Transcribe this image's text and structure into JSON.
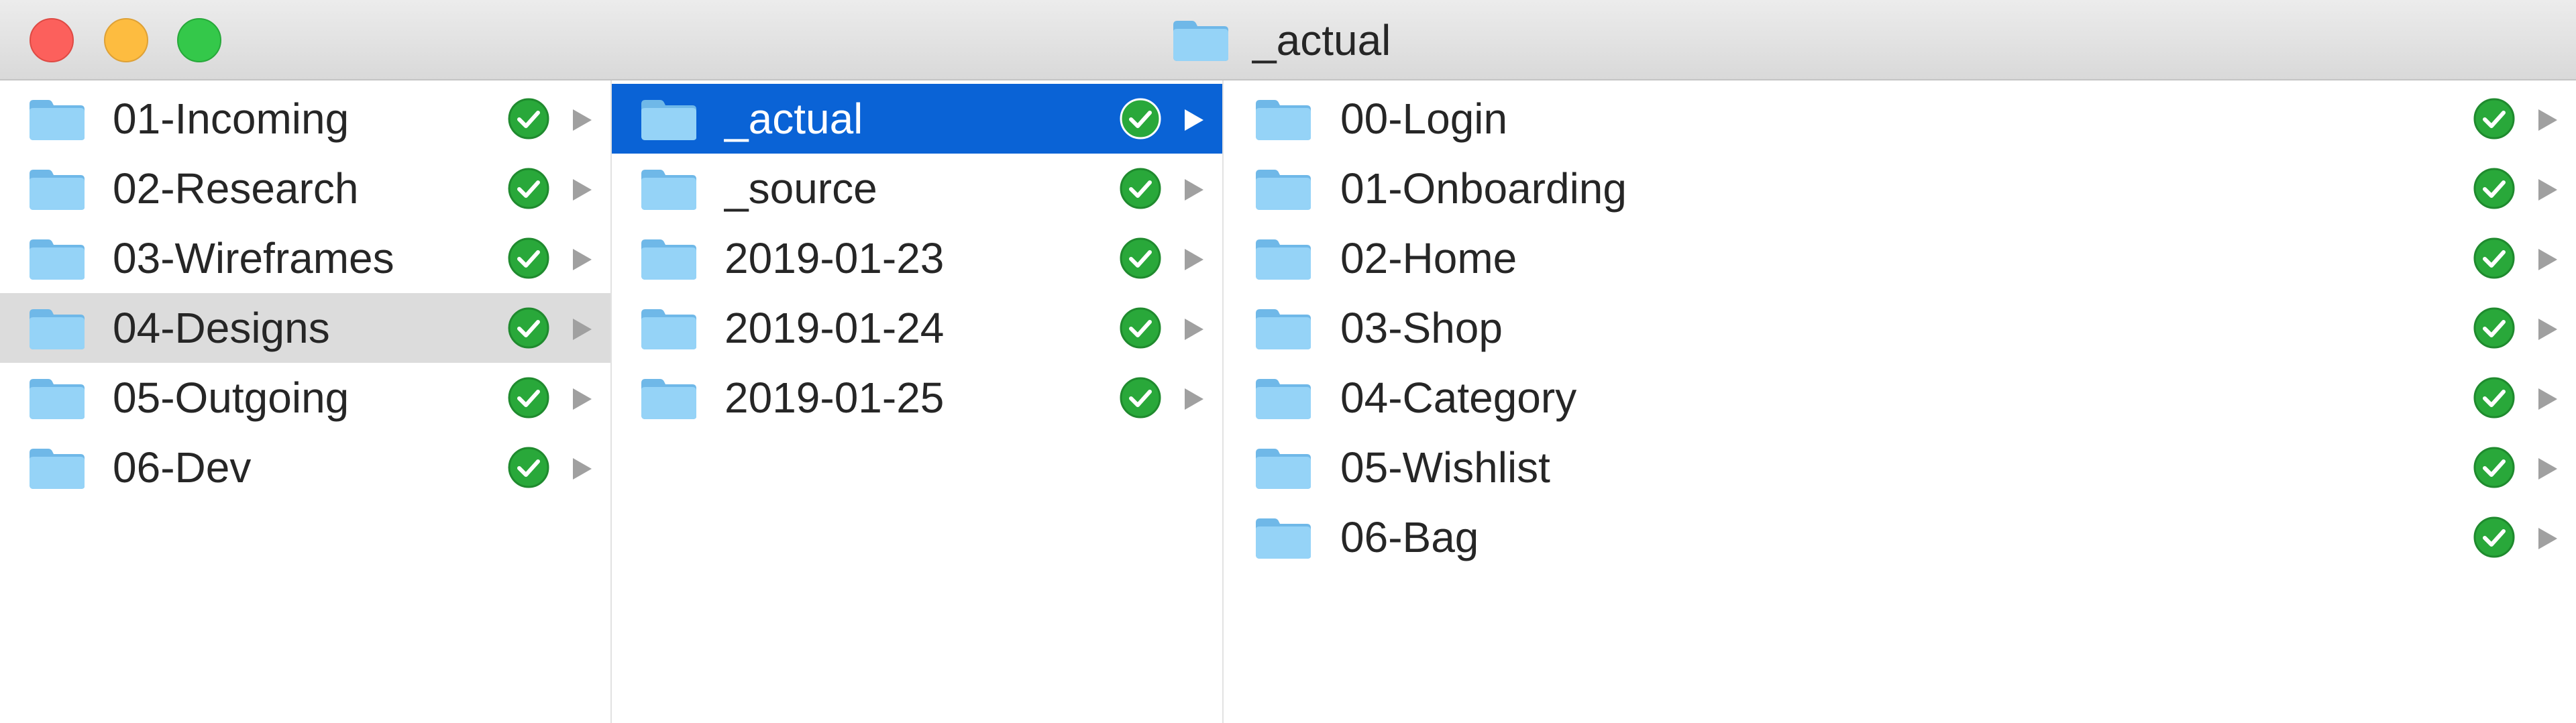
{
  "window": {
    "title": "_actual"
  },
  "icons": {
    "folder": "folder-icon",
    "status": "synced-check-icon",
    "chevron": "chevron-right-icon"
  },
  "colors": {
    "selection_active": "#0a63d6",
    "selection_inactive": "#dcdcdc",
    "folder": "#8fd0f5",
    "check": "#29a83a"
  },
  "columns": [
    {
      "items": [
        {
          "label": "01-Incoming"
        },
        {
          "label": "02-Research"
        },
        {
          "label": "03-Wireframes"
        },
        {
          "label": "04-Designs",
          "selected": "inactive"
        },
        {
          "label": "05-Outgoing"
        },
        {
          "label": "06-Dev"
        }
      ]
    },
    {
      "items": [
        {
          "label": "_actual",
          "selected": "active"
        },
        {
          "label": "_source"
        },
        {
          "label": "2019-01-23"
        },
        {
          "label": "2019-01-24"
        },
        {
          "label": "2019-01-25"
        }
      ]
    },
    {
      "items": [
        {
          "label": "00-Login"
        },
        {
          "label": "01-Onboarding"
        },
        {
          "label": "02-Home"
        },
        {
          "label": "03-Shop"
        },
        {
          "label": "04-Category"
        },
        {
          "label": "05-Wishlist"
        },
        {
          "label": "06-Bag"
        }
      ]
    }
  ]
}
